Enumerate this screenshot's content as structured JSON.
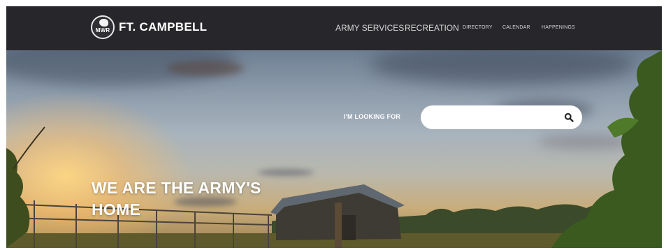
{
  "header": {
    "logo_badge": "MWR",
    "site_name": "FT. CAMPBELL",
    "nav": [
      {
        "label": "ARMY SERVICES"
      },
      {
        "label": "RECREATION"
      },
      {
        "label": "DIRECTORY"
      },
      {
        "label": "CALENDAR"
      },
      {
        "label": "HAPPENINGS"
      }
    ]
  },
  "hero": {
    "search_label": "I'M LOOKING FOR",
    "search_value": "",
    "search_icon": "search-icon",
    "headline_line1": "WE ARE THE ARMY'S",
    "headline_line2": "HOME"
  },
  "colors": {
    "topbar": "#27272b",
    "nav_text": "#d6d6d6",
    "white": "#ffffff"
  }
}
